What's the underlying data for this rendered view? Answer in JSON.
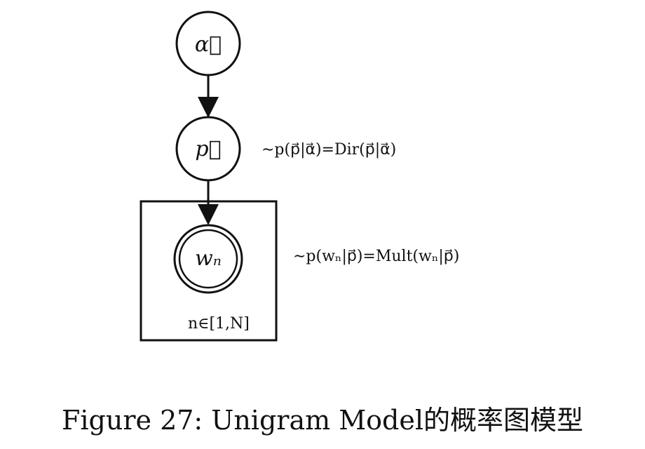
{
  "diagram": {
    "nodes": {
      "alpha": {
        "label": "α⃗"
      },
      "p": {
        "label": "p⃗"
      },
      "w": {
        "label": "wₙ"
      }
    },
    "equations": {
      "p_dist": "∼p(p⃗|α⃗)=Dir(p⃗|α⃗)",
      "w_dist": "∼p(wₙ|p⃗)=Mult(wₙ|p⃗)"
    },
    "plate": {
      "label": "n∈[1,N]"
    }
  },
  "caption": {
    "text": "Figure 27: Unigram Model的概率图模型"
  }
}
